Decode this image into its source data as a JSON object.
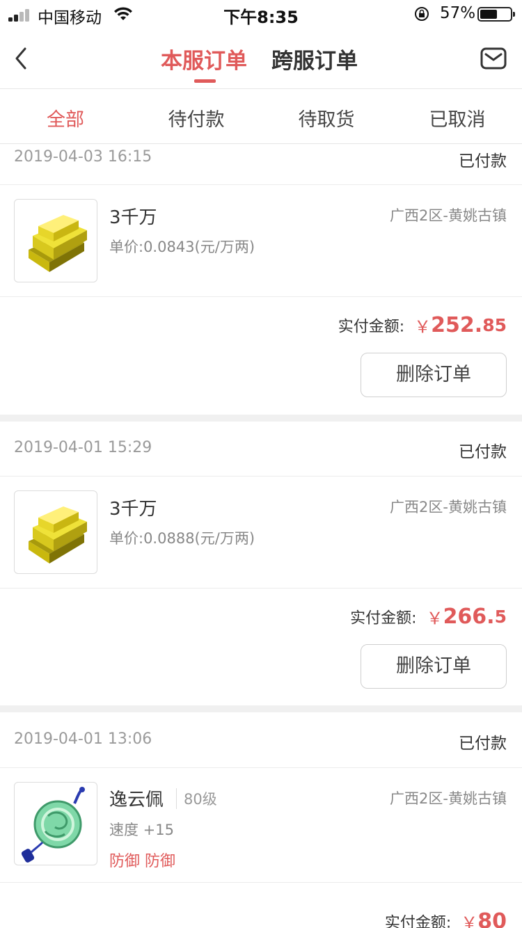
{
  "status_bar": {
    "carrier": "中国移动",
    "time": "下午8:35",
    "battery": "57%",
    "battery_level": 0.57,
    "icons": [
      "signal-icon",
      "wifi-icon",
      "orientation-lock-icon",
      "battery-icon"
    ]
  },
  "nav": {
    "back_icon": "chevron-left-icon",
    "tabs": [
      {
        "label": "本服订单",
        "active": true
      },
      {
        "label": "跨服订单",
        "active": false
      }
    ],
    "message_icon": "mail-icon"
  },
  "filters": [
    {
      "label": "全部",
      "active": true
    },
    {
      "label": "待付款",
      "active": false
    },
    {
      "label": "待取货",
      "active": false
    },
    {
      "label": "已取消",
      "active": false
    }
  ],
  "colors": {
    "accent": "#e05a5a",
    "divider": "#ececec",
    "background_gap": "#f0f0f0"
  },
  "orders": [
    {
      "date": "2019-04-03 16:15",
      "status": "已付款",
      "item_icon": "gold-bars-icon",
      "name": "3千万",
      "unit_price": "单价:0.0843(元/万两)",
      "server": "广西2区-黄姚古镇",
      "pay_label": "实付金额:",
      "currency": "￥",
      "amount_int": "252.",
      "amount_dec": "85",
      "delete_label": "删除订单"
    },
    {
      "date": "2019-04-01 15:29",
      "status": "已付款",
      "item_icon": "gold-bars-icon",
      "name": "3千万",
      "unit_price": "单价:0.0888(元/万两)",
      "server": "广西2区-黄姚古镇",
      "pay_label": "实付金额:",
      "currency": "￥",
      "amount_int": "266.",
      "amount_dec": "5",
      "delete_label": "删除订单"
    },
    {
      "date": "2019-04-01 13:06",
      "status": "已付款",
      "item_icon": "jade-pendant-icon",
      "name": "逸云佩",
      "level": "80级",
      "stat": "速度 +15",
      "tags": "防御 防御",
      "server": "广西2区-黄姚古镇",
      "pay_label": "实付金额:",
      "currency": "￥",
      "amount_int": "80",
      "amount_dec": ""
    }
  ]
}
